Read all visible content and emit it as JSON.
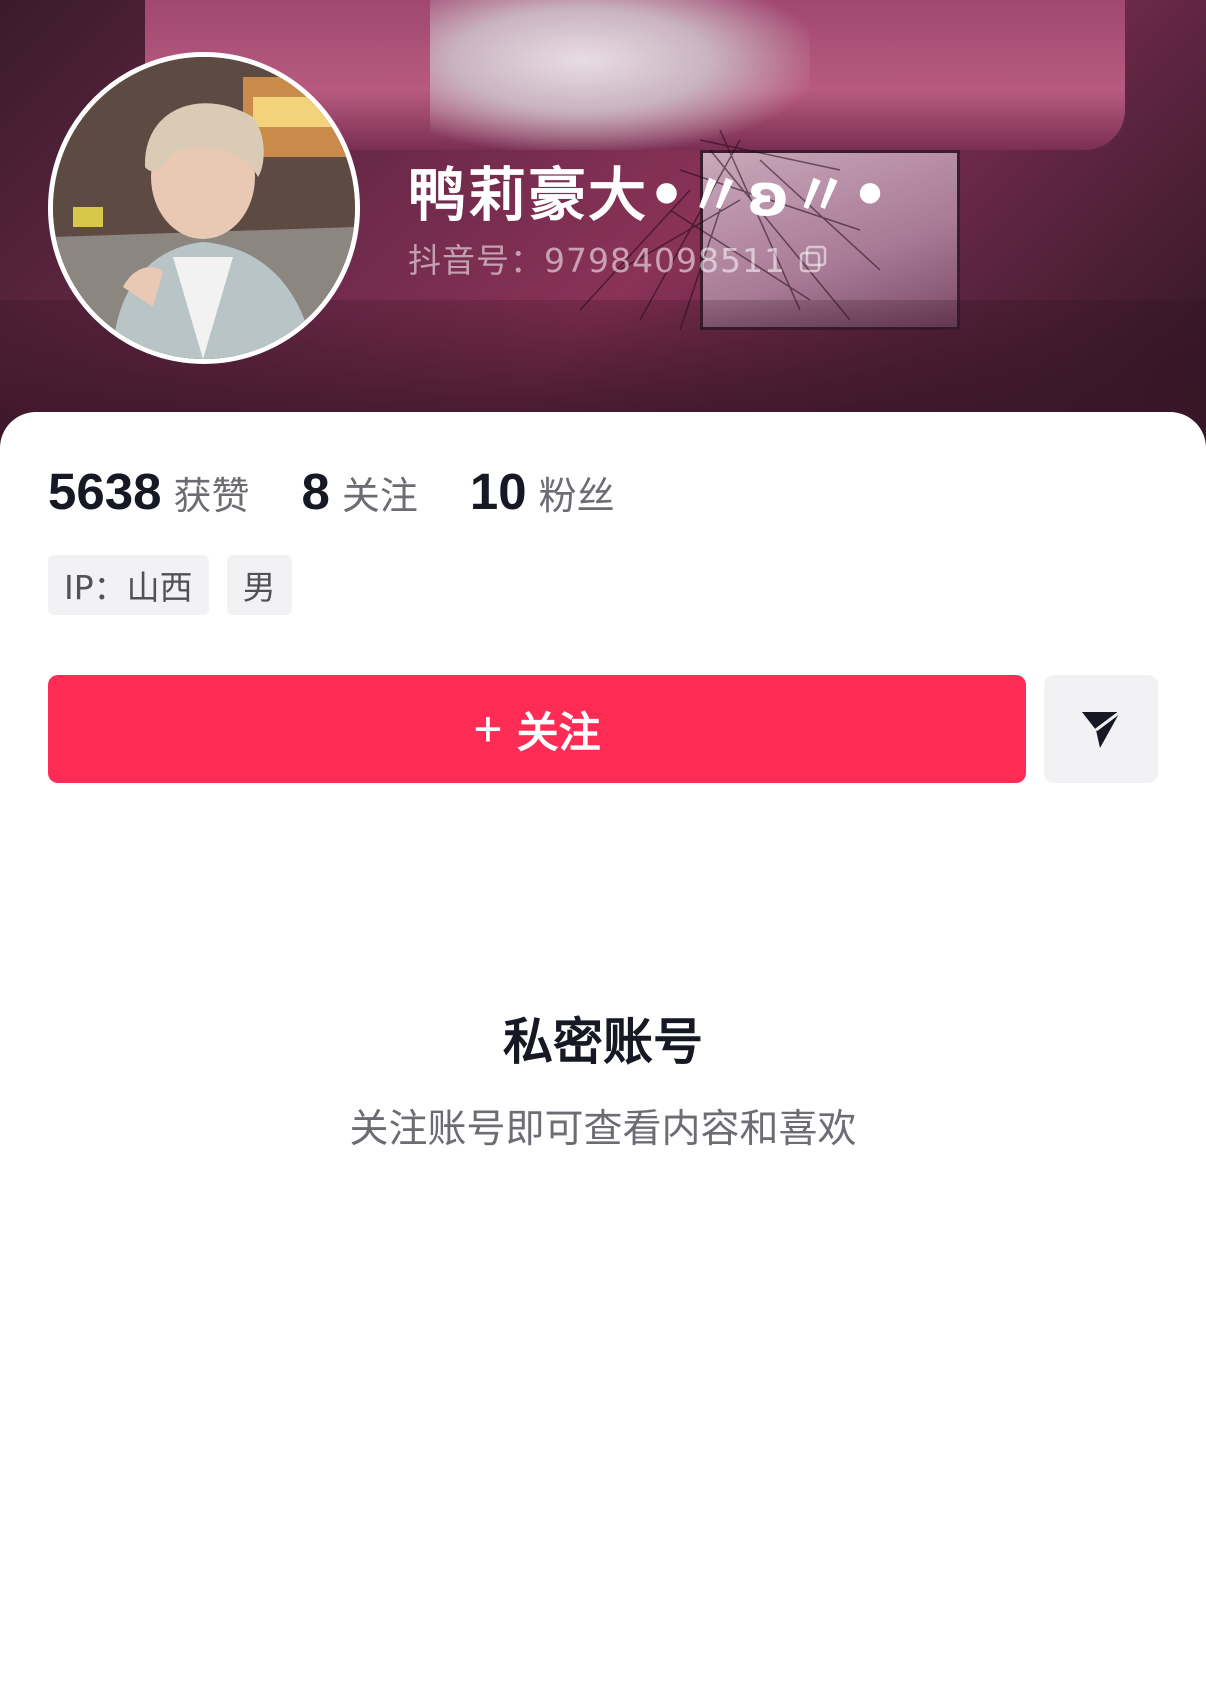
{
  "profile": {
    "nickname": "鸭莉豪大•〃ʚ〃•",
    "douyin_id": "抖音号：97984098511",
    "icons": {
      "copy": "copy-icon",
      "send": "send-message-icon"
    }
  },
  "stats": [
    {
      "num": "5638",
      "label": "获赞"
    },
    {
      "num": "8",
      "label": "关注"
    },
    {
      "num": "10",
      "label": "粉丝"
    }
  ],
  "tags": [
    "IP：山西",
    "男"
  ],
  "actions": {
    "follow_plus": "+",
    "follow_label": "关注"
  },
  "private": {
    "title": "私密账号",
    "subtitle": "关注账号即可查看内容和喜欢"
  },
  "colors": {
    "accent": "#fe2c55",
    "text": "#161823",
    "muted": "#6b6d73",
    "chip": "#f2f2f4"
  }
}
